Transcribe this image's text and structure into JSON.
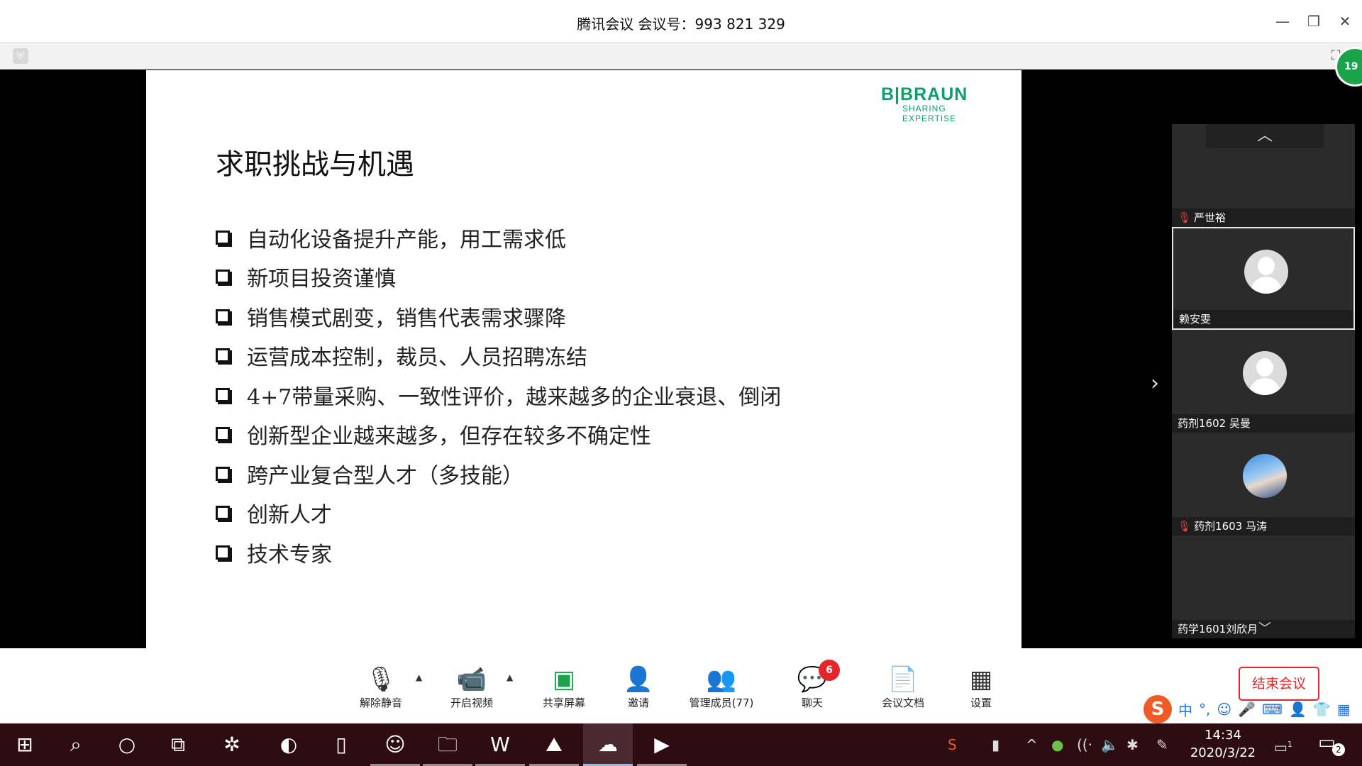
{
  "window": {
    "title": "腾讯会议 会议号：993 821 329"
  },
  "badge": {
    "count": "19"
  },
  "slide": {
    "logo_brand": "B|BRAUN",
    "logo_tagline": "SHARING EXPERTISE",
    "title": "求职挑战与机遇",
    "bullets": [
      "自动化设备提升产能，用工需求低",
      "新项目投资谨慎",
      "销售模式剧变，销售代表需求骤降",
      "运营成本控制，裁员、人员招聘冻结",
      "4+7带量采购、一致性评价，越来越多的企业衰退、倒闭",
      "创新型企业越来越多，但存在较多不确定性",
      "跨产业复合型人才（多技能）",
      "创新人才",
      "技术专家"
    ]
  },
  "participants": [
    {
      "name": "严世裕",
      "muted": true,
      "avatar": "none"
    },
    {
      "name": "赖安雯",
      "muted": false,
      "avatar": "default",
      "selected": true
    },
    {
      "name": "药剂1602 吴曼",
      "muted": false,
      "avatar": "default"
    },
    {
      "name": "药剂1603 马涛",
      "muted": true,
      "avatar": "photo"
    },
    {
      "name": "药学1601刘欣月",
      "muted": false,
      "avatar": "none"
    }
  ],
  "controls": {
    "unmute": "解除静音",
    "video": "开启视频",
    "share": "共享屏幕",
    "invite": "邀请",
    "members": "管理成员(77)",
    "chat": "聊天",
    "chat_badge": "6",
    "docs": "会议文档",
    "settings": "设置",
    "end": "结束会议"
  },
  "ime": {
    "lang": "中",
    "punct": "°,"
  },
  "taskbar": {
    "time": "14:34",
    "date": "2020/3/22",
    "notif_count": "2",
    "desktop_count": "1"
  }
}
